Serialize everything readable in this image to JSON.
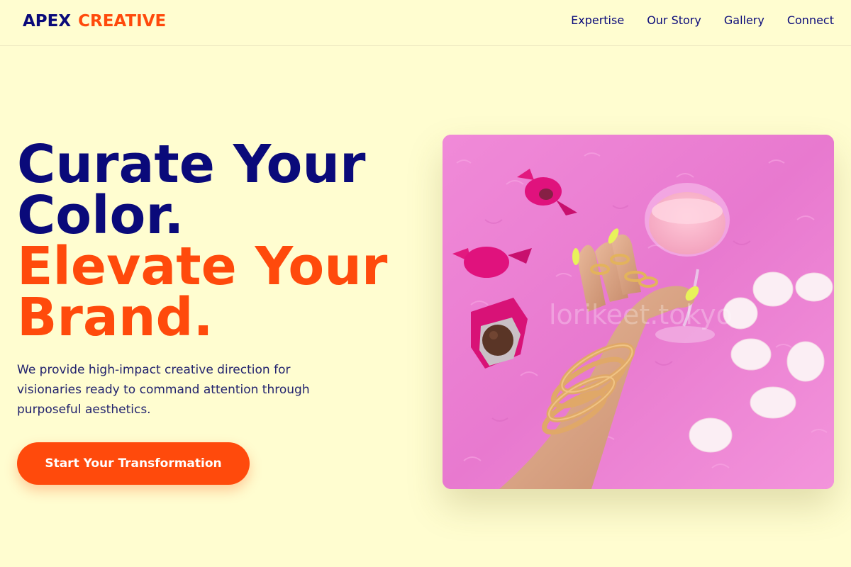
{
  "brand": {
    "part1": "APEX",
    "part2": "CREATIVE"
  },
  "nav": {
    "items": [
      {
        "label": "Expertise"
      },
      {
        "label": "Our Story"
      },
      {
        "label": "Gallery"
      },
      {
        "label": "Connect"
      }
    ]
  },
  "hero": {
    "title_line1": "Curate Your",
    "title_line2": "Color.",
    "title_line3": "Elevate Your",
    "title_line4": "Brand.",
    "description": "We provide high-impact creative direction for visionaries ready to command attention through purposeful aesthetics.",
    "cta_label": "Start Your Transformation",
    "image_watermark": "lorikeet.tokyo"
  },
  "colors": {
    "background": "#FFFDD0",
    "navy": "#0A0A7A",
    "accent_orange": "#FF4A0C",
    "image_pink": "#E97CD0"
  }
}
